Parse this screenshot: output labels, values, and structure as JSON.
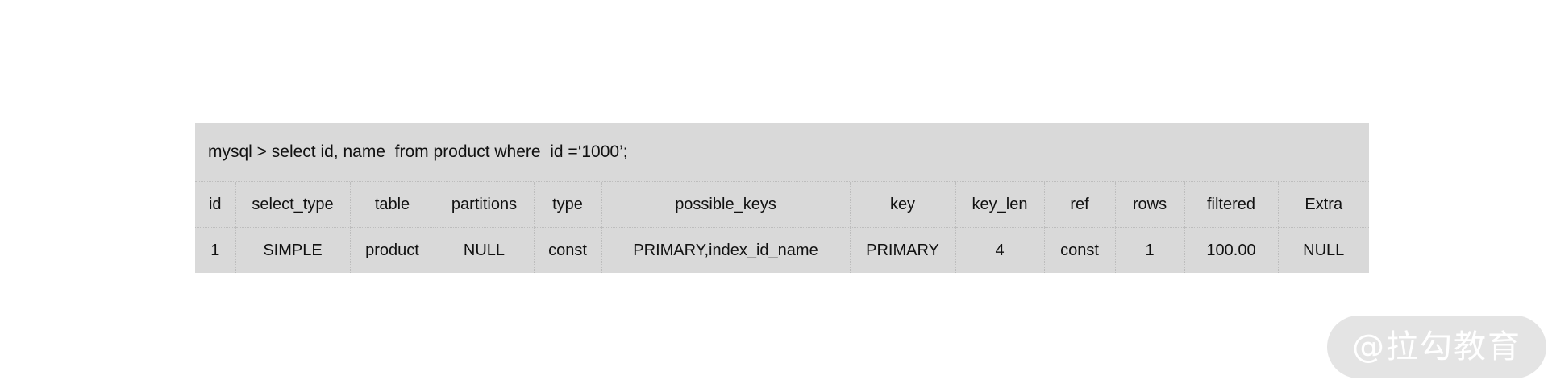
{
  "query": {
    "text": "mysql > select id, name  from product where  id =‘1000’;"
  },
  "explain_table": {
    "columns": [
      "id",
      "select_type",
      "table",
      "partitions",
      "type",
      "possible_keys",
      "key",
      "key_len",
      "ref",
      "rows",
      "filtered",
      "Extra"
    ],
    "rows": [
      [
        "1",
        "SIMPLE",
        "product",
        "NULL",
        "const",
        "PRIMARY,index_id_name",
        "PRIMARY",
        "4",
        "const",
        "1",
        "100.00",
        "NULL"
      ]
    ]
  },
  "watermark": {
    "text": "@拉勾教育"
  }
}
